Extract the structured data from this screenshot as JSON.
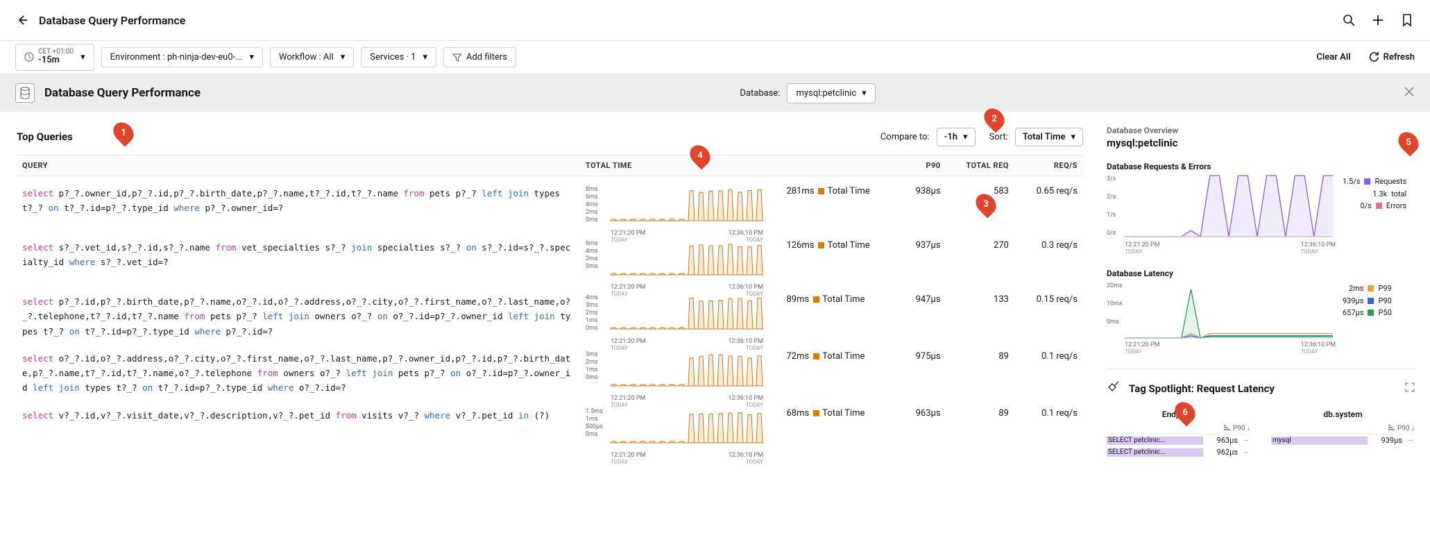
{
  "header": {
    "title": "Database Query Performance"
  },
  "filters": {
    "time_zone": "CET +01:00",
    "time_range": "-15m",
    "environment": "Environment : ph-ninja-dev-eu0-...",
    "workflow": "Workflow : All",
    "services": "Services · 1",
    "add_filters": "Add filters",
    "clear_all": "Clear All",
    "refresh": "Refresh"
  },
  "panel_header": {
    "title": "Database Query Performance",
    "database_label": "Database:",
    "database_value": "mysql:petclinic"
  },
  "top_queries": {
    "title": "Top Queries",
    "compare_label": "Compare to:",
    "compare_value": "-1h",
    "sort_label": "Sort:",
    "sort_value": "Total Time",
    "columns": {
      "query": "QUERY",
      "total_time": "TOTAL TIME",
      "p90": "P90",
      "total_req": "TOTAL REQ",
      "reqs": "REQ/S"
    },
    "time_start": "12:21:20 PM",
    "time_end": "12:36:10 PM",
    "today": "TODAY",
    "total_time_label": "Total Time",
    "rows": [
      {
        "query_html": "<span class='kw-select'>select</span> p?_?.owner_id,p?_?.id,p?_?.birth_date,p?_?.name,t?_?.id,t?_?.name <span class='kw-from'>from</span> pets p?_? <span class='kw-left'>left</span> <span class='kw-join'>join</span> types t?_? <span class='kw-on'>on</span> t?_?.id=p?_?.type_id <span class='kw-where'>where</span> p?_?.owner_id=?",
        "yticks": [
          "8ms",
          "6ms",
          "4ms",
          "2ms",
          "0ms"
        ],
        "total_time": "281ms",
        "p90": "938µs",
        "total_req": "583",
        "reqs": "0.65 req/s"
      },
      {
        "query_html": "<span class='kw-select'>select</span> s?_?.vet_id,s?_?.id,s?_?.name <span class='kw-from'>from</span> vet_specialties s?_? <span class='kw-join'>join</span> specialties s?_? <span class='kw-on'>on</span> s?_?.id=s?_?.specialty_id <span class='kw-where'>where</span> s?_?.vet_id=?",
        "yticks": [
          "6ms",
          "4ms",
          "2ms",
          "0ms"
        ],
        "total_time": "126ms",
        "p90": "937µs",
        "total_req": "270",
        "reqs": "0.3 req/s"
      },
      {
        "query_html": "<span class='kw-select'>select</span> p?_?.id,p?_?.birth_date,p?_?.name,o?_?.id,o?_?.address,o?_?.city,o?_?.first_name,o?_?.last_name,o?_?.telephone,t?_?.id,t?_?.name <span class='kw-from'>from</span> pets p?_? <span class='kw-left'>left</span> <span class='kw-join'>join</span> owners o?_? <span class='kw-on'>on</span> o?_?.id=p?_?.owner_id <span class='kw-left'>left</span> <span class='kw-join'>join</span> types t?_? <span class='kw-on'>on</span> t?_?.id=p?_?.type_id <span class='kw-where'>where</span> p?_?.id=?",
        "yticks": [
          "4ms",
          "3ms",
          "2ms",
          "1ms",
          "0ms"
        ],
        "total_time": "89ms",
        "p90": "947µs",
        "total_req": "133",
        "reqs": "0.15 req/s"
      },
      {
        "query_html": "<span class='kw-select'>select</span> o?_?.id,o?_?.address,o?_?.city,o?_?.first_name,o?_?.last_name,p?_?.owner_id,p?_?.id,p?_?.birth_date,p?_?.name,t?_?.id,t?_?.name,o?_?.telephone <span class='kw-from'>from</span> owners o?_? <span class='kw-left'>left</span> <span class='kw-join'>join</span> pets p?_? <span class='kw-on'>on</span> o?_?.id=p?_?.owner_id <span class='kw-left'>left</span> <span class='kw-join'>join</span> types t?_? <span class='kw-on'>on</span> t?_?.id=p?_?.type_id <span class='kw-where'>where</span> o?_?.id=?",
        "yticks": [
          "3ms",
          "2ms",
          "1ms",
          "0ms"
        ],
        "total_time": "72ms",
        "p90": "975µs",
        "total_req": "89",
        "reqs": "0.1 req/s"
      },
      {
        "query_html": "<span class='kw-select'>select</span> v?_?.id,v?_?.visit_date,v?_?.description,v?_?.pet_id <span class='kw-from'>from</span> visits v?_? <span class='kw-where'>where</span> v?_?.pet_id <span class='kw-join'>in</span> (?)",
        "yticks": [
          "1.5ms",
          "1ms",
          "500µs",
          "0ms"
        ],
        "total_time": "68ms",
        "p90": "963µs",
        "total_req": "89",
        "reqs": "0.1 req/s"
      }
    ]
  },
  "overview": {
    "title": "Database Overview",
    "db": "mysql:petclinic",
    "requests_errors": {
      "title": "Database Requests & Errors",
      "yticks": [
        "3/s",
        "2/s",
        "1/s",
        "0/s"
      ],
      "time_start": "12:21:20 PM",
      "time_end": "12:36:10 PM",
      "today": "TODAY",
      "legend": [
        {
          "value": "1.5/s",
          "swatch": "#8a5cf5",
          "label": "Requests"
        },
        {
          "value": "1.3k",
          "swatch": "",
          "label": "total"
        },
        {
          "value": "0/s",
          "swatch": "#f06a8a",
          "label": "Errors"
        }
      ]
    },
    "latency": {
      "title": "Database Latency",
      "yticks": [
        "20ms",
        "10ms",
        "0ms"
      ],
      "time_start": "12:21:20 PM",
      "time_end": "12:36:10 PM",
      "today": "TODAY",
      "legend": [
        {
          "value": "2ms",
          "swatch": "#e8a33d",
          "label": "P99"
        },
        {
          "value": "939µs",
          "swatch": "#2b6dd6",
          "label": "P90"
        },
        {
          "value": "657µs",
          "swatch": "#1fa35a",
          "label": "P50"
        }
      ]
    }
  },
  "spotlight": {
    "title": "Tag Spotlight: Request Latency",
    "cols": [
      {
        "name": "Endpoint",
        "p90_label": "P90",
        "rows": [
          {
            "label": "SELECT petclinic...",
            "value": "963µs"
          },
          {
            "label": "SELECT petclinic...",
            "value": "962µs"
          }
        ]
      },
      {
        "name": "db.system",
        "p90_label": "P90",
        "rows": [
          {
            "label": "mysql",
            "value": "939µs"
          }
        ]
      }
    ]
  },
  "markers": [
    "1",
    "2",
    "3",
    "4",
    "5",
    "6"
  ],
  "chart_data": [
    {
      "type": "line",
      "title": "Database Requests & Errors",
      "ylabel": "req/s",
      "ylim": [
        0,
        3
      ],
      "x_range": [
        "12:21:20 PM",
        "12:36:10 PM"
      ],
      "series": [
        {
          "name": "Requests",
          "color": "#8a5cf5",
          "values": [
            0,
            0,
            0,
            0,
            0,
            0,
            0,
            0.3,
            0,
            3,
            3,
            0,
            3,
            3,
            0,
            3,
            3,
            0,
            3,
            3,
            0,
            3,
            3
          ]
        },
        {
          "name": "Errors",
          "color": "#f06a8a",
          "values": [
            0,
            0,
            0,
            0,
            0,
            0,
            0,
            0,
            0,
            0,
            0,
            0,
            0,
            0,
            0,
            0,
            0,
            0,
            0,
            0,
            0,
            0,
            0
          ]
        }
      ]
    },
    {
      "type": "line",
      "title": "Database Latency",
      "ylabel": "ms",
      "ylim": [
        0,
        25
      ],
      "x_range": [
        "12:21:20 PM",
        "12:36:10 PM"
      ],
      "series": [
        {
          "name": "P99",
          "color": "#e8a33d",
          "values": [
            0,
            0,
            0,
            0,
            0,
            0,
            0,
            2,
            0,
            2,
            2,
            2,
            2,
            2,
            2,
            2,
            2,
            2,
            2,
            2,
            2,
            2,
            2
          ]
        },
        {
          "name": "P90",
          "color": "#2b6dd6",
          "values": [
            0,
            0,
            0,
            0,
            0,
            0,
            0,
            1,
            0,
            1,
            1,
            1,
            1,
            1,
            1,
            1,
            1,
            1,
            1,
            1,
            1,
            1,
            1
          ]
        },
        {
          "name": "P50",
          "color": "#1fa35a",
          "values": [
            0,
            0,
            0,
            0,
            0,
            0,
            0,
            22,
            0,
            0.7,
            0.7,
            0.7,
            0.7,
            0.7,
            0.7,
            0.7,
            0.7,
            0.7,
            0.7,
            0.7,
            0.7,
            0.7,
            0.7
          ]
        }
      ]
    }
  ]
}
